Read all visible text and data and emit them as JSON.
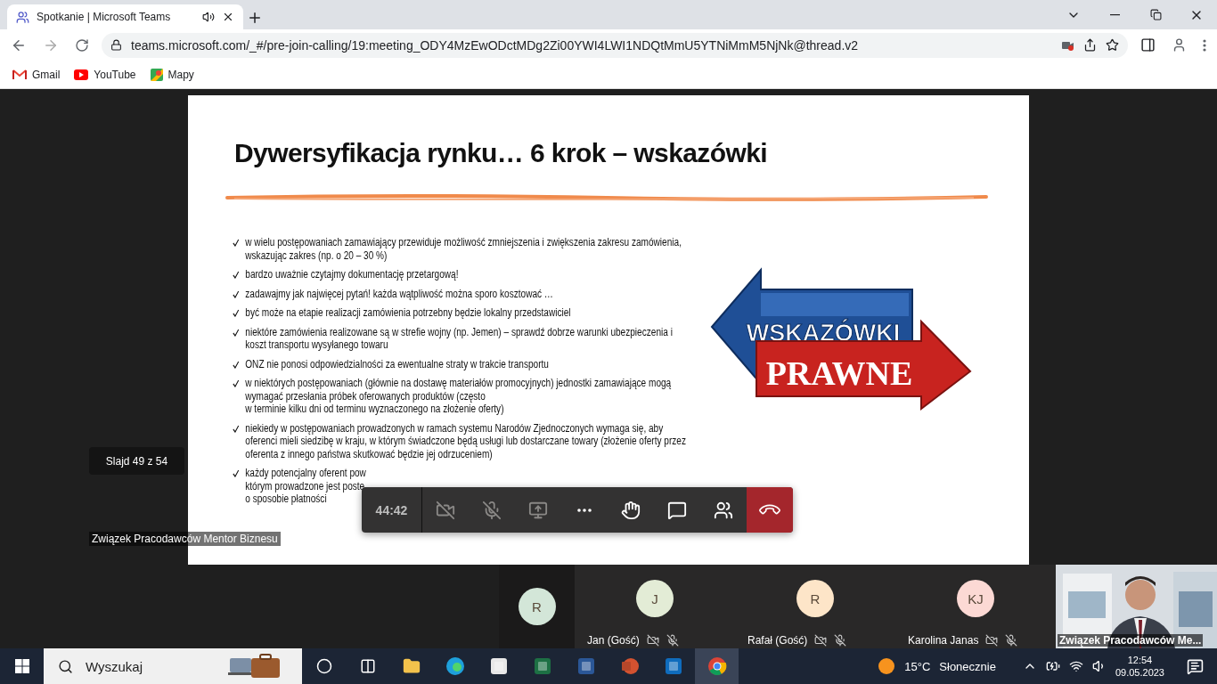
{
  "browser": {
    "tab_title": "Spotkanie | Microsoft Teams",
    "address": "teams.microsoft.com/_#/pre-join-calling/19:meeting_ODY4MzEwODctMDg2Zi00YWI4LWI1NDQtMmU5YTNiMmM5NjNk@thread.v2",
    "bookmarks": [
      {
        "label": "Gmail",
        "kind": "gmail"
      },
      {
        "label": "YouTube",
        "kind": "youtube"
      },
      {
        "label": "Mapy",
        "kind": "maps"
      }
    ]
  },
  "stage": {
    "slide_counter": "Slajd 49 z 54",
    "presenter": "Związek Pracodawców Mentor Biznesu"
  },
  "slide": {
    "title": "Dywersyfikacja rynku… 6 krok – wskazówki",
    "bullets": [
      "w wielu postępowaniach zamawiający przewiduje możliwość zmniejszenia i zwiększenia zakresu zamówienia,\nwskazując zakres (np. o 20 – 30 %)",
      "bardzo uważnie czytajmy dokumentację przetargową!",
      "zadawajmy jak najwięcej pytań! każda wątpliwość można sporo kosztować …",
      "być może na etapie realizacji zamówienia potrzebny będzie lokalny przedstawiciel",
      "niektóre zamówienia realizowane są w strefie wojny (np. Jemen) – sprawdź dobrze warunki ubezpieczenia i\nkoszt transportu wysyłanego towaru",
      "ONZ nie ponosi odpowiedzialności za ewentualne straty w trakcie transportu",
      "w niektórych postępowaniach (głównie na dostawę materiałów promocyjnych) jednostki zamawiające mogą\nwymagać przesłania próbek oferowanych produktów (często\nw terminie kilku dni od terminu wyznaczonego na złożenie oferty)",
      "niekiedy w postępowaniach prowadzonych w ramach systemu Narodów Zjednoczonych wymaga się, aby\noferenci mieli siedzibę w kraju, w którym świadczone będą usługi lub dostarczane towary (złożenie oferty przez\noferenta z innego państwa skutkować będzie jej odrzuceniem)",
      "każdy potencjalny oferent pow\nktórym prowadzone jest poste\no sposobie płatności"
    ],
    "graphic": {
      "top_word": "WSKAZÓWKI",
      "bottom_word": "PRAWNE"
    }
  },
  "call_controls": {
    "timer": "44:42",
    "camera_on": false,
    "mic_on": false
  },
  "participants": [
    {
      "initials": "R",
      "color": "#d3e6d8"
    },
    {
      "initials": "J",
      "name": "Jan (Gość)",
      "color": "#e3ecd6"
    },
    {
      "initials": "R",
      "name": "Rafał (Gość)",
      "color": "#fde5c8"
    },
    {
      "initials": "KJ",
      "name": "Karolina Janas",
      "color": "#fcd9d4"
    }
  ],
  "video_tile": {
    "name": "Związek Pracodawców Me...",
    "kind": "picture"
  },
  "taskbar": {
    "search_placeholder": "Wyszukaj",
    "temperature": "15°C",
    "weather": "Słonecznie",
    "time": "12:54",
    "date": "09.05.2023"
  }
}
